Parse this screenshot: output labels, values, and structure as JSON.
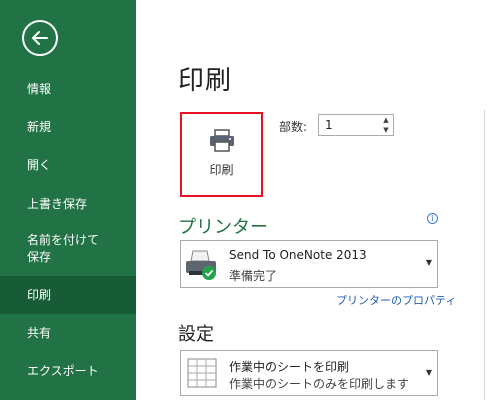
{
  "sidebar": {
    "items": [
      {
        "label": "情報"
      },
      {
        "label": "新規"
      },
      {
        "label": "開く"
      },
      {
        "label": "上書き保存"
      },
      {
        "label": "名前を付けて\n保存"
      },
      {
        "label": "印刷"
      },
      {
        "label": "共有"
      },
      {
        "label": "エクスポート"
      }
    ],
    "active": "印刷"
  },
  "main": {
    "title": "印刷",
    "print_button_label": "印刷",
    "copies_label": "部数:",
    "copies_value": "1",
    "printer_heading": "プリンター",
    "printer": {
      "name": "Send To OneNote 2013",
      "status": "準備完了"
    },
    "printer_properties_link": "プリンターのプロパティ",
    "settings_heading": "設定",
    "settings": {
      "title": "作業中のシートを印刷",
      "description": "作業中のシートのみを印刷します"
    }
  },
  "colors": {
    "sidebar_bg": "#217346",
    "sidebar_active": "#185c37",
    "highlight_border": "#e81123",
    "link": "#1e5fb4"
  }
}
